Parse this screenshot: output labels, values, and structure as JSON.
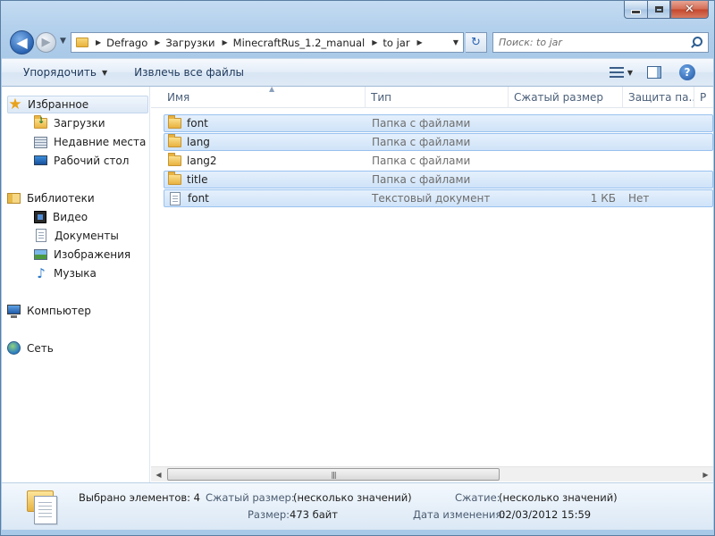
{
  "window": {
    "close_glyph": "✕"
  },
  "nav": {
    "back_glyph": "◀",
    "forward_glyph": "▶",
    "breadcrumbs": [
      "Defrago",
      "Загрузки",
      "MinecraftRus_1.2_manual",
      "to jar"
    ],
    "refresh_glyph": "↻",
    "search_placeholder": "Поиск: to jar"
  },
  "toolbar": {
    "organize_label": "Упорядочить",
    "extract_label": "Извлечь все файлы",
    "help_glyph": "?"
  },
  "sidebar": {
    "favorites": {
      "label": "Избранное",
      "icon": "star-icon"
    },
    "favorite_items": [
      {
        "label": "Загрузки",
        "icon": "downloads-folder-icon"
      },
      {
        "label": "Недавние места",
        "icon": "recent-places-icon"
      },
      {
        "label": "Рабочий стол",
        "icon": "desktop-icon"
      }
    ],
    "libraries": {
      "label": "Библиотеки",
      "icon": "libraries-icon"
    },
    "library_items": [
      {
        "label": "Видео",
        "icon": "video-icon"
      },
      {
        "label": "Документы",
        "icon": "documents-icon"
      },
      {
        "label": "Изображения",
        "icon": "pictures-icon"
      },
      {
        "label": "Музыка",
        "icon": "music-icon"
      }
    ],
    "computer": {
      "label": "Компьютер",
      "icon": "computer-icon"
    },
    "network": {
      "label": "Сеть",
      "icon": "network-icon"
    }
  },
  "columns": {
    "name": "Имя",
    "type": "Тип",
    "compressed_size": "Сжатый размер",
    "protection": "Защита па...",
    "extra": "Р"
  },
  "files": [
    {
      "name": "font",
      "type": "Папка с файлами",
      "size": "",
      "protection": "",
      "kind": "folder",
      "selected": true
    },
    {
      "name": "lang",
      "type": "Папка с файлами",
      "size": "",
      "protection": "",
      "kind": "folder",
      "selected": true
    },
    {
      "name": "lang2",
      "type": "Папка с файлами",
      "size": "",
      "protection": "",
      "kind": "folder",
      "selected": false
    },
    {
      "name": "title",
      "type": "Папка с файлами",
      "size": "",
      "protection": "",
      "kind": "folder",
      "selected": true
    },
    {
      "name": "font",
      "type": "Текстовый документ",
      "size": "1 КБ",
      "protection": "Нет",
      "kind": "document",
      "selected": true
    }
  ],
  "scrollbar": {
    "left_glyph": "◀",
    "right_glyph": "▶",
    "grip": "|||"
  },
  "details": {
    "selected_text": "Выбрано элементов: 4",
    "compressed_size_label": "Сжатый размер:",
    "compressed_size_value": "(несколько значений)",
    "compression_label": "Сжатие:",
    "compression_value": "(несколько значений)",
    "size_label": "Размер:",
    "size_value": "473 байт",
    "modified_label": "Дата изменения:",
    "modified_value": "02/03/2012 15:59"
  }
}
